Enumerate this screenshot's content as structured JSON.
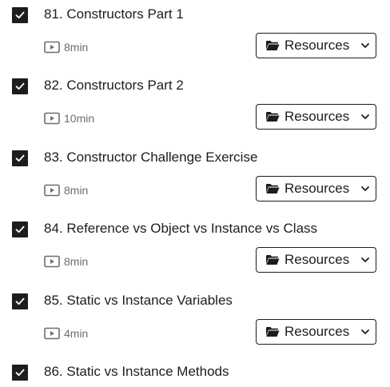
{
  "lectures": [
    {
      "title": "81. Constructors Part 1",
      "duration": "8min",
      "resources_label": "Resources",
      "completed": true
    },
    {
      "title": "82. Constructors Part 2",
      "duration": "10min",
      "resources_label": "Resources",
      "completed": true
    },
    {
      "title": "83. Constructor Challenge Exercise",
      "duration": "8min",
      "resources_label": "Resources",
      "completed": true
    },
    {
      "title": "84. Reference vs Object vs Instance vs Class",
      "duration": "8min",
      "resources_label": "Resources",
      "completed": true
    },
    {
      "title": "85. Static vs Instance Variables",
      "duration": "4min",
      "resources_label": "Resources",
      "completed": true
    },
    {
      "title": "86. Static vs Instance Methods",
      "completed": true
    }
  ],
  "icons": {
    "checkbox": "checkmark-icon",
    "video": "video-play-icon",
    "folder": "folder-icon",
    "chevron": "chevron-down-icon"
  },
  "colors": {
    "text": "#1c1d1f",
    "muted": "#6a6f73",
    "checkbox_fill": "#1c1d1f"
  }
}
